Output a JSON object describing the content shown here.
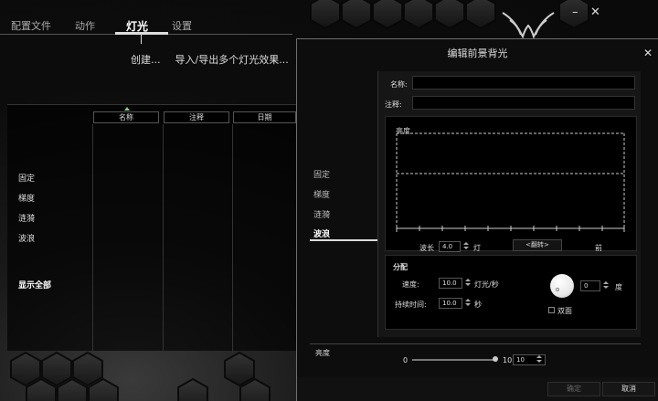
{
  "app": {
    "tabs": [
      {
        "label": "配置文件",
        "active": false
      },
      {
        "label": "动作",
        "active": false
      },
      {
        "label": "灯光",
        "active": true
      },
      {
        "label": "设置",
        "active": false
      }
    ],
    "links": {
      "create": "创建...",
      "import_export": "导入/导出多个灯光效果..."
    },
    "window_controls": {
      "minimize": "–",
      "close": "✕"
    },
    "columns": [
      "名称",
      "注释",
      "日期"
    ],
    "left_list": [
      "固定",
      "梯度",
      "涟漪",
      "波浪"
    ],
    "show_all": "显示全部"
  },
  "dialog": {
    "title": "编辑前景背光",
    "close": "✕",
    "name_label": "名称:",
    "name_value": "",
    "comment_label": "注释:",
    "comment_value": "",
    "side_items": [
      {
        "label": "固定",
        "active": false
      },
      {
        "label": "梯度",
        "active": false
      },
      {
        "label": "涟漪",
        "active": false
      },
      {
        "label": "波浪",
        "active": true
      }
    ],
    "chart_title": "亮度",
    "wavelength_label": "波长",
    "wavelength_value": "4.0",
    "wavelength_unit": "灯",
    "flip_button": "<翻转>",
    "front_label": "前",
    "params_title": "分配",
    "speed_label": "速度:",
    "speed_value": "10.0",
    "speed_unit": "灯光/秒",
    "duration_label": "持续时间:",
    "duration_value": "10.0",
    "duration_unit": "秒",
    "angle_value": "0",
    "angle_unit": "度",
    "bidirectional_label": "双面",
    "brightness_label": "亮度",
    "brightness_min": "0",
    "brightness_max": "10",
    "brightness_value": "10",
    "brightness_level": 1.0,
    "ok_button": "确定",
    "cancel_button": "取消"
  },
  "colors": {
    "accent": "#dddddd",
    "background": "#0b0b0b",
    "dialog_border": "#6e6e6e",
    "sort_arrow": "#88cc88"
  }
}
